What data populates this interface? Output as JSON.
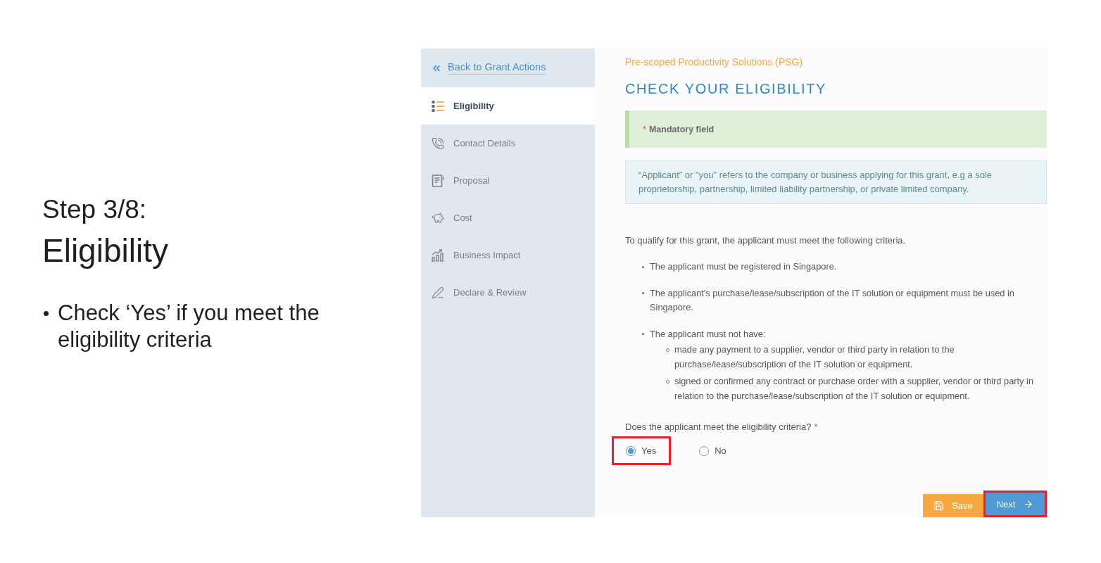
{
  "slide": {
    "step": "Step 3/8:",
    "title": "Eligibility",
    "bullets": [
      "Check ‘Yes’ if you meet the eligibility criteria"
    ]
  },
  "sidebar": {
    "back_link": "Back to Grant Actions",
    "items": [
      {
        "label": "Eligibility",
        "selected": true
      },
      {
        "label": "Contact Details",
        "selected": false
      },
      {
        "label": "Proposal",
        "selected": false
      },
      {
        "label": "Cost",
        "selected": false
      },
      {
        "label": "Business Impact",
        "selected": false
      },
      {
        "label": "Declare & Review",
        "selected": false
      }
    ]
  },
  "main": {
    "grant_name": "Pre-scoped Productivity Solutions (PSG)",
    "title": "CHECK YOUR ELIGIBILITY",
    "mandatory_note": {
      "mark": "*",
      "text": "Mandatory field"
    },
    "info": "“Applicant” or \"you\" refers to the company or business applying for this grant, e.g a sole proprietorship, partnership, limited liability partnership, or private limited company.",
    "intro": "To qualify for this grant, the applicant must meet the following criteria.",
    "criteria": [
      {
        "text": "The applicant must be registered in Singapore."
      },
      {
        "text": "The applicant's purchase/lease/subscription of the IT solution or equipment must be used in Singapore."
      },
      {
        "text": "The applicant must not have:",
        "children": [
          {
            "text": "made any payment to a supplier, vendor or third party in relation to the purchase/lease/subscription of the IT solution or equipment."
          },
          {
            "text": "signed or confirmed any contract or purchase order with a supplier, vendor or third party in relation to the purchase/lease/subscription of the IT solution or equipment."
          }
        ]
      }
    ],
    "question": {
      "text": "Does the applicant meet the eligibility criteria?",
      "mark": "*"
    },
    "options": [
      {
        "label": "Yes",
        "selected": true,
        "highlighted": true
      },
      {
        "label": "No",
        "selected": false,
        "highlighted": false
      }
    ],
    "buttons": [
      {
        "label": "Save",
        "kind": "save",
        "highlighted": false
      },
      {
        "label": "Next",
        "kind": "next",
        "highlighted": true
      }
    ]
  }
}
